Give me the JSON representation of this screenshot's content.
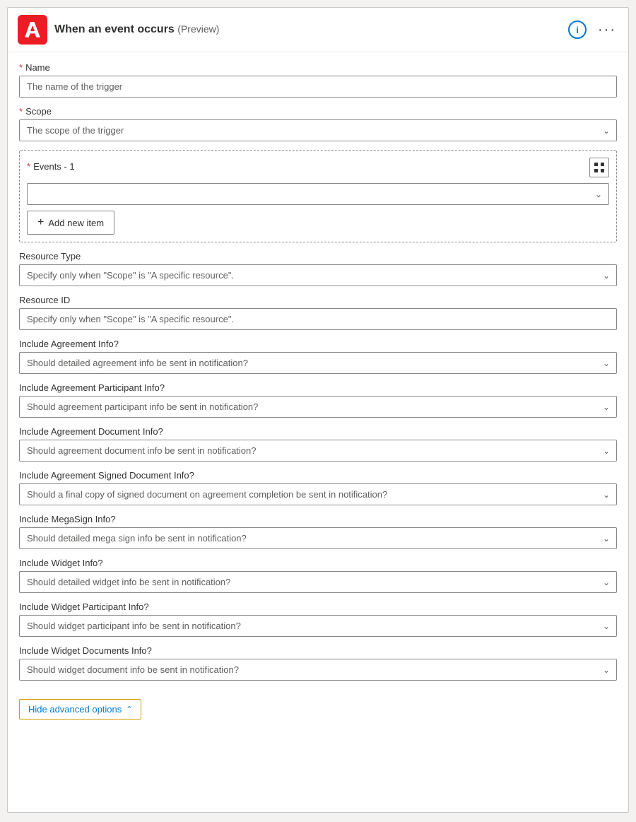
{
  "header": {
    "title": "When an event occurs",
    "preview_label": "(Preview)",
    "info_icon": "info-icon",
    "more_icon": "more-options-icon"
  },
  "fields": {
    "name": {
      "label": "Name",
      "required": true,
      "placeholder": "The name of the trigger",
      "value": "The name of the trigger"
    },
    "scope": {
      "label": "Scope",
      "required": true,
      "placeholder": "The scope of the trigger",
      "value": "The scope of the trigger"
    },
    "events": {
      "label": "Events - 1",
      "required": true,
      "placeholder": "",
      "add_item_label": "Add new item"
    },
    "resource_type": {
      "label": "Resource Type",
      "required": false,
      "placeholder": "Specify only when \"Scope\" is \"A specific resource\".",
      "value": "Specify only when \"Scope\" is \"A specific resource\"."
    },
    "resource_id": {
      "label": "Resource ID",
      "required": false,
      "placeholder": "Specify only when \"Scope\" is \"A specific resource\".",
      "value": "Specify only when \"Scope\" is \"A specific resource\"."
    },
    "include_agreement_info": {
      "label": "Include Agreement Info?",
      "required": false,
      "placeholder": "Should detailed agreement info be sent in notification?",
      "value": "Should detailed agreement info be sent in notification?"
    },
    "include_agreement_participant_info": {
      "label": "Include Agreement Participant Info?",
      "required": false,
      "placeholder": "Should agreement participant info be sent in notification?",
      "value": "Should agreement participant info be sent in notification?"
    },
    "include_agreement_document_info": {
      "label": "Include Agreement Document Info?",
      "required": false,
      "placeholder": "Should agreement document info be sent in notification?",
      "value": "Should agreement document info be sent in notification?"
    },
    "include_agreement_signed_document_info": {
      "label": "Include Agreement Signed Document Info?",
      "required": false,
      "placeholder": "Should a final copy of signed document on agreement completion be sent in notification?",
      "value": "Should a final copy of signed document on agreement completion be sent in notification?"
    },
    "include_megasign_info": {
      "label": "Include MegaSign Info?",
      "required": false,
      "placeholder": "Should detailed mega sign info be sent in notification?",
      "value": "Should detailed mega sign info be sent in notification?"
    },
    "include_widget_info": {
      "label": "Include Widget Info?",
      "required": false,
      "placeholder": "Should detailed widget info be sent in notification?",
      "value": "Should detailed widget info be sent in notification?"
    },
    "include_widget_participant_info": {
      "label": "Include Widget Participant Info?",
      "required": false,
      "placeholder": "Should widget participant info be sent in notification?",
      "value": "Should widget participant info be sent in notification?"
    },
    "include_widget_documents_info": {
      "label": "Include Widget Documents Info?",
      "required": false,
      "placeholder": "Should widget document info be sent in notification?",
      "value": "Should widget document info be sent in notification?"
    }
  },
  "hide_advanced_label": "Hide advanced options"
}
